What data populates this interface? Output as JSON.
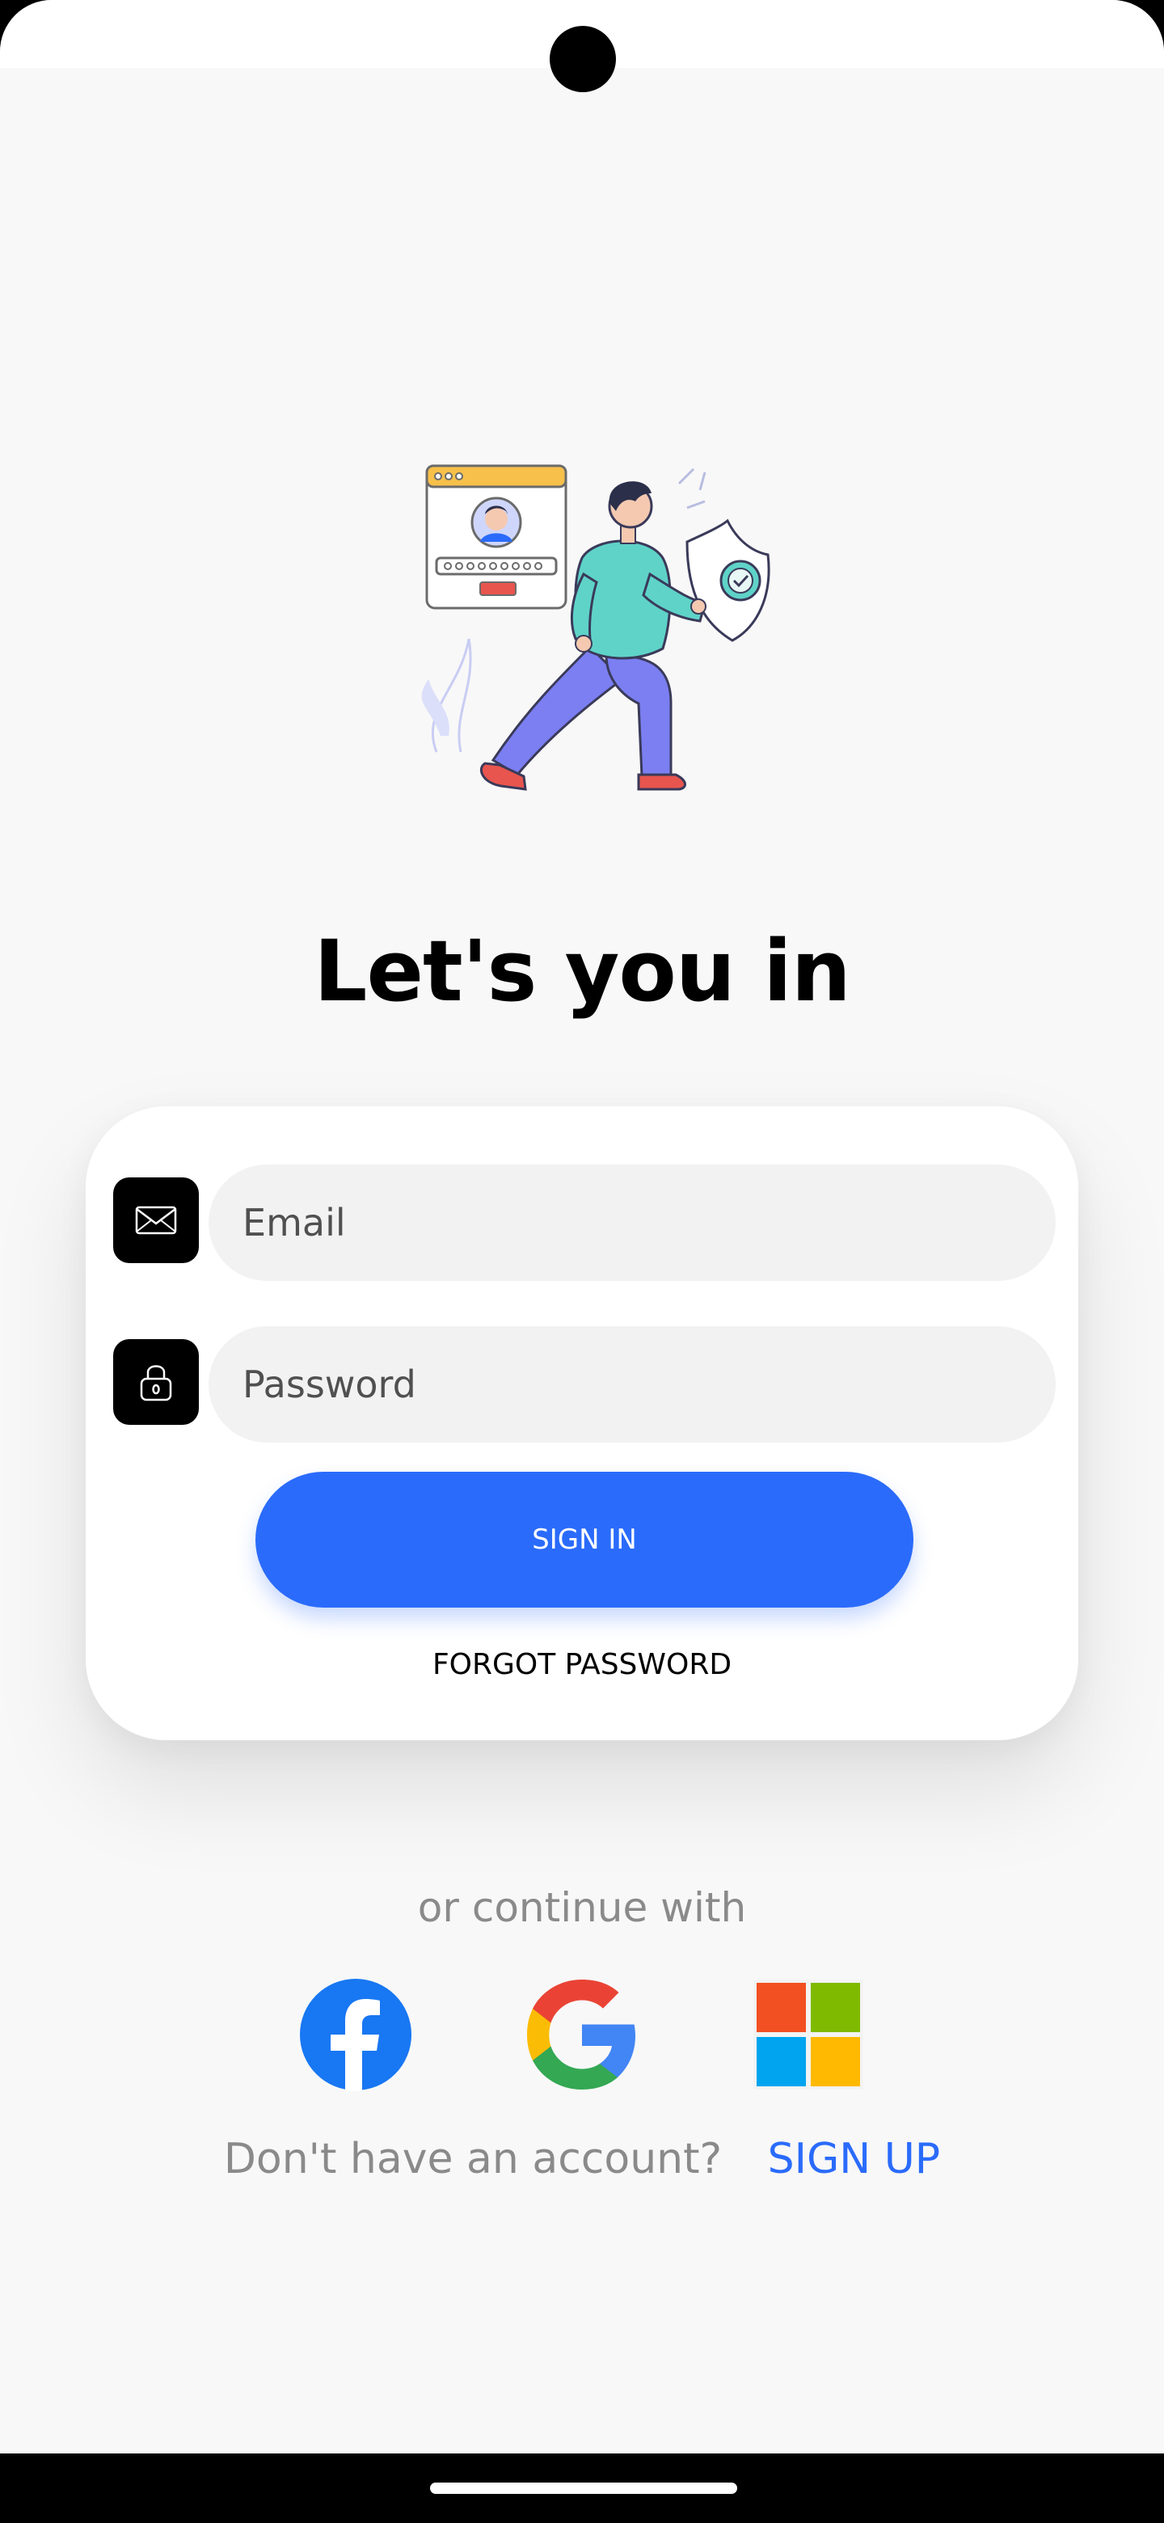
{
  "title": "Let's you in",
  "form": {
    "email_placeholder": "Email",
    "password_placeholder": "Password",
    "signin_label": "SIGN IN",
    "forgot_label": "FORGOT PASSWORD"
  },
  "social": {
    "continue_text": "or continue with",
    "providers": [
      {
        "name": "Facebook",
        "icon": "facebook-icon",
        "color": "#1877f2"
      },
      {
        "name": "Google",
        "icon": "google-icon",
        "color": "#4285f4"
      },
      {
        "name": "Microsoft",
        "icon": "microsoft-icon",
        "color": "#f25022"
      }
    ]
  },
  "signup": {
    "question": "Don't have an account?",
    "link_label": "SIGN UP"
  },
  "colors": {
    "accent": "#2a6bfb",
    "background": "#f8f8f8",
    "input_bg": "#f2f2f2",
    "muted_text": "#8a8a8a"
  }
}
